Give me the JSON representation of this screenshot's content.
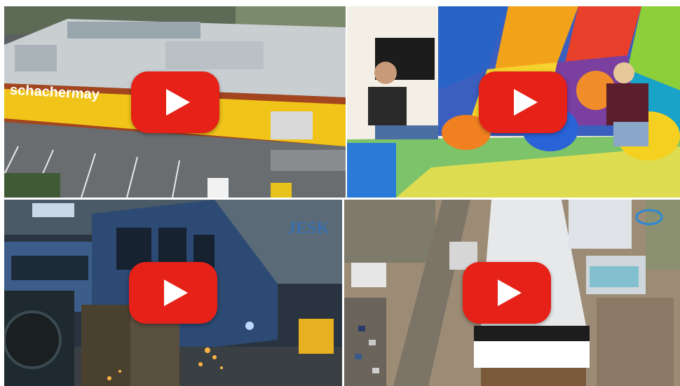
{
  "videos": [
    {
      "sign_text": "schachermay",
      "play_label": "Play video",
      "colors": {
        "sky": "#4a5560",
        "roof": "#c9ced1",
        "facade": "#f0c419",
        "ground": "#5c5f62"
      }
    },
    {
      "play_label": "Play video",
      "colors": {
        "wall": "#f4efe6",
        "floor": "#7cc36a",
        "mural_a": "#f2a31a",
        "mural_b": "#2a63c6"
      }
    },
    {
      "logo_text": "JESK",
      "play_label": "Play video",
      "colors": {
        "hall": "#2a3440",
        "train": "#3c5d8a",
        "sparks": "#ffb347"
      }
    },
    {
      "play_label": "Play video",
      "colors": {
        "ground": "#9c8c76",
        "roof": "#e6e8ea",
        "road": "#7d7468"
      }
    }
  ],
  "colors": {
    "youtube_red": "#e62117",
    "play_white": "#ffffff"
  }
}
